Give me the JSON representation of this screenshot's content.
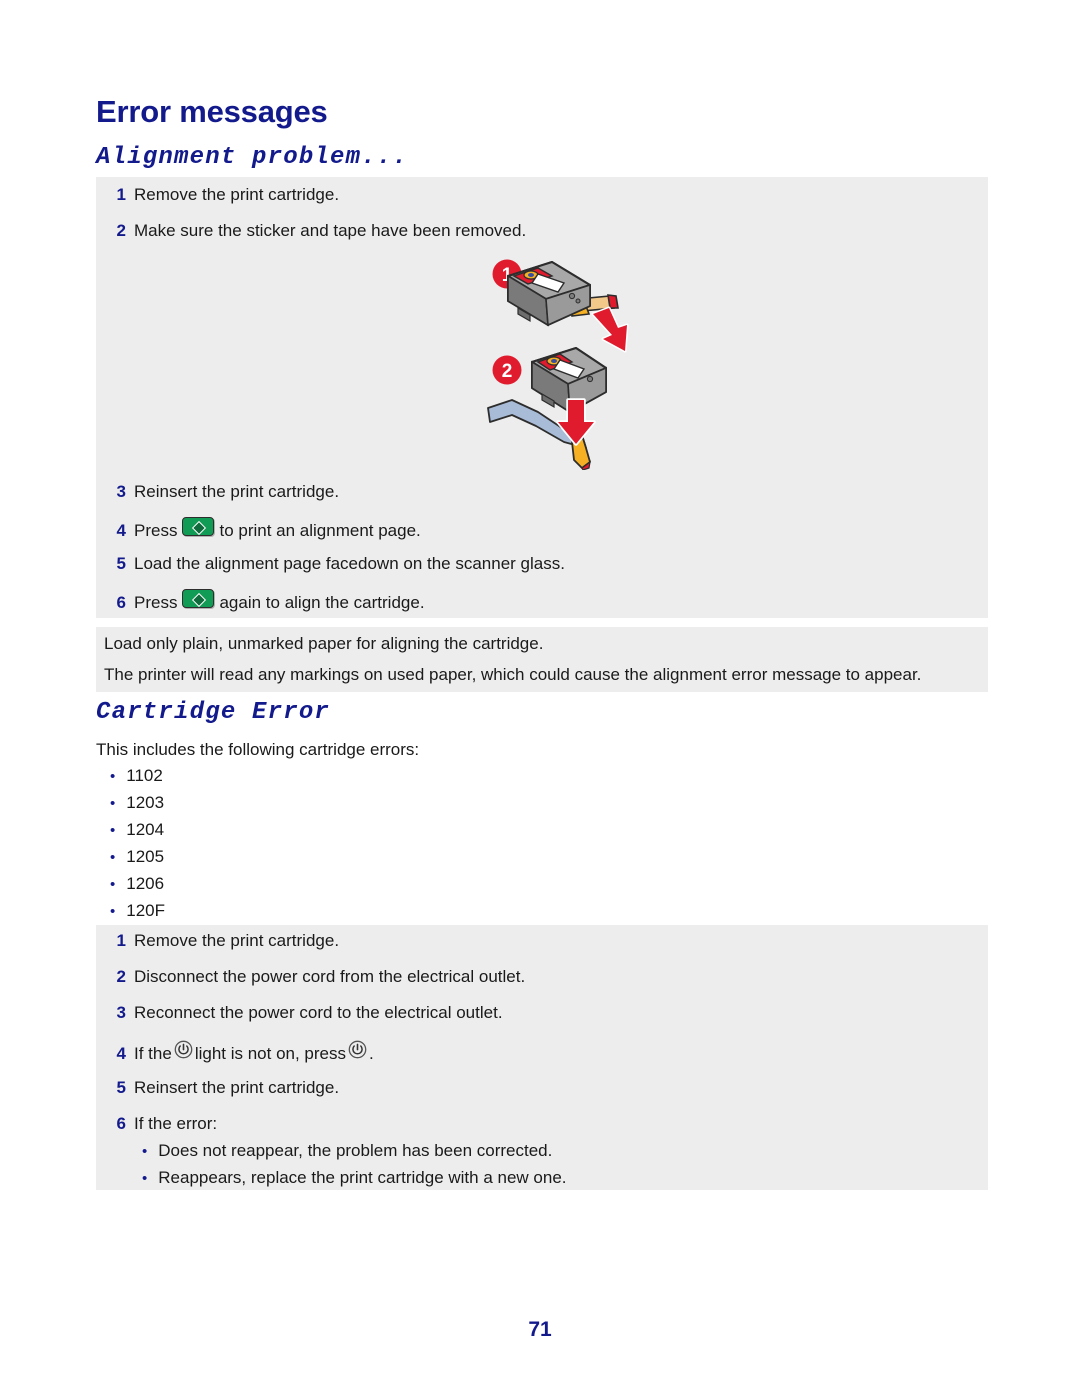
{
  "document": {
    "title": "Error messages",
    "page_number": "71"
  },
  "sections": [
    {
      "heading": "Alignment problem...",
      "steps_top": [
        {
          "num": "1",
          "text": "Remove the print cartridge."
        },
        {
          "num": "2",
          "text": "Make sure the sticker and tape have been removed."
        }
      ],
      "illustration": {
        "callouts": [
          "1",
          "2"
        ],
        "description": "Print cartridge with sticker and tape being removed",
        "colors": {
          "callout_circle": "#e01b2e",
          "arrow": "#e01b2e",
          "cartridge_body": "#8c8c8c",
          "tape": "#f5b024",
          "sticker": "#a8bcd8"
        }
      },
      "steps_bottom": [
        {
          "num": "3",
          "text_before": "Reinsert the print cartridge.",
          "icon": "",
          "text_after": ""
        },
        {
          "num": "4",
          "text_before": "Press",
          "icon": "green-start-button-icon",
          "text_after": "to print an alignment page."
        },
        {
          "num": "5",
          "text_before": "Load the alignment page facedown on the scanner glass.",
          "icon": "",
          "text_after": ""
        },
        {
          "num": "6",
          "text_before": "Press",
          "icon": "green-start-button-icon",
          "text_after": "again to align the cartridge."
        }
      ],
      "notes": [
        "Load only plain, unmarked paper for aligning the cartridge.",
        "The printer will read any markings on used paper, which could cause the alignment error message to appear."
      ]
    },
    {
      "heading": "Cartridge Error",
      "intro": "This includes the following cartridge errors:",
      "error_codes": [
        "1102",
        "1203",
        "1204",
        "1205",
        "1206",
        "120F"
      ],
      "steps": [
        {
          "num": "1",
          "text_before": "Remove the print cartridge.",
          "icon": "",
          "text_mid": "",
          "icon2": "",
          "text_after": ""
        },
        {
          "num": "2",
          "text_before": "Disconnect the power cord from the electrical outlet.",
          "icon": "",
          "text_mid": "",
          "icon2": "",
          "text_after": ""
        },
        {
          "num": "3",
          "text_before": "Reconnect the power cord to the electrical outlet.",
          "icon": "",
          "text_mid": "",
          "icon2": "",
          "text_after": ""
        },
        {
          "num": "4",
          "text_before": "If the",
          "icon": "power-icon",
          "text_mid": "light is not on, press",
          "icon2": "power-icon",
          "text_after": "."
        },
        {
          "num": "5",
          "text_before": "Reinsert the print cartridge.",
          "icon": "",
          "text_mid": "",
          "icon2": "",
          "text_after": ""
        },
        {
          "num": "6",
          "text_before": "If the error:",
          "icon": "",
          "text_mid": "",
          "icon2": "",
          "text_after": ""
        }
      ],
      "sub_bullets": [
        "Does not reappear, the problem has been corrected.",
        "Reappears, replace the print cartridge with a new one."
      ]
    }
  ],
  "theme": {
    "heading_color": "#131a8c",
    "block_background": "#ededed",
    "body_text_color": "#1a1a1a",
    "accent_red": "#e01b2e",
    "button_green": "#119c55"
  }
}
